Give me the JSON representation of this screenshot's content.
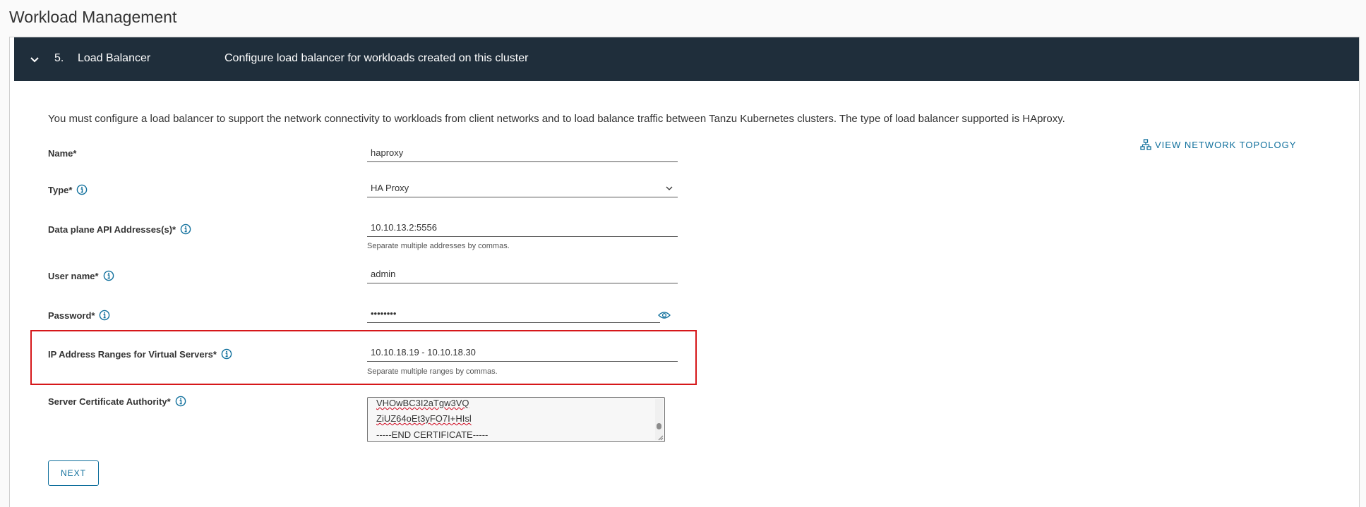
{
  "page": {
    "title": "Workload Management"
  },
  "step": {
    "number": "5.",
    "name": "Load Balancer",
    "description": "Configure load balancer for workloads created on this cluster"
  },
  "intro": "You must configure a load balancer to support the network connectivity to workloads from client networks and to load balance traffic between Tanzu Kubernetes clusters. The type of load balancer supported is HAproxy.",
  "topology_link": "VIEW NETWORK TOPOLOGY",
  "form": {
    "name": {
      "label": "Name*",
      "value": "haproxy"
    },
    "type": {
      "label": "Type*",
      "value": "HA Proxy"
    },
    "dataplane": {
      "label": "Data plane API Addresses(s)*",
      "value": "10.10.13.2:5556",
      "helper": "Separate multiple addresses by commas."
    },
    "username": {
      "label": "User name*",
      "value": "admin"
    },
    "password": {
      "label": "Password*",
      "value": "••••••••"
    },
    "ip_ranges": {
      "label": "IP Address Ranges for Virtual Servers*",
      "value": "10.10.18.19 - 10.10.18.30",
      "helper": "Separate multiple ranges by commas."
    },
    "cert": {
      "label": "Server Certificate Authority*",
      "lines": [
        "VHOwBC3I2aTgw3VQ",
        "ZiUZ64oEt3yFO7I+HIsl",
        "-----END CERTIFICATE-----"
      ]
    }
  },
  "next_label": "NEXT",
  "colors": {
    "header_bg": "#1f2e3b",
    "accent": "#0f6f9c",
    "highlight": "#d6171a"
  }
}
